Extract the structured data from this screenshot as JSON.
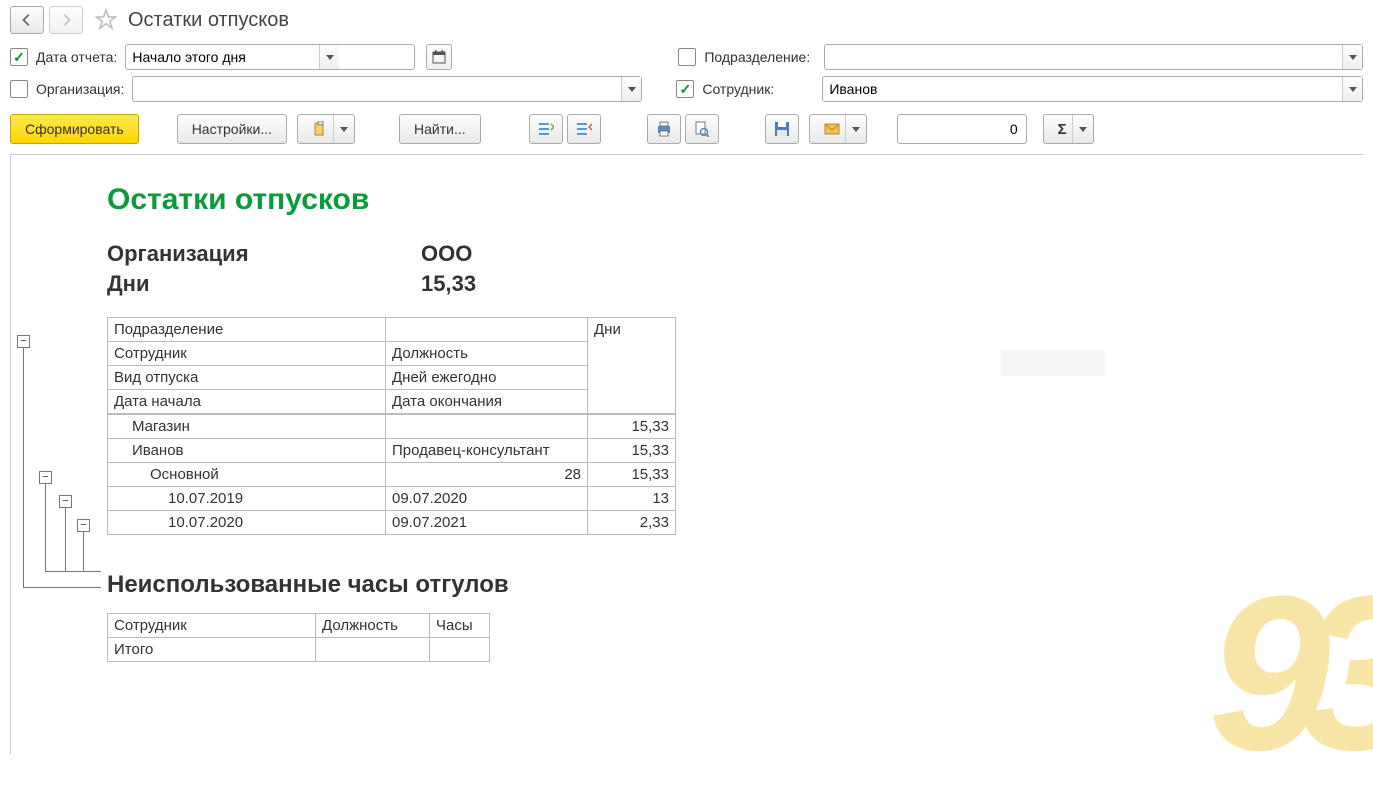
{
  "header": {
    "title": "Остатки отпусков"
  },
  "filters": {
    "report_date": {
      "label": "Дата отчета:",
      "value": "Начало этого дня",
      "checked": true
    },
    "subdivision": {
      "label": "Подразделение:",
      "value": "",
      "checked": false
    },
    "organization": {
      "label": "Организация:",
      "value": "",
      "checked": false
    },
    "employee": {
      "label": "Сотрудник:",
      "value": "Иванов",
      "checked": true
    }
  },
  "toolbar": {
    "generate_label": "Сформировать",
    "settings_label": "Настройки...",
    "find_label": "Найти...",
    "numeric_value": "0"
  },
  "report": {
    "title": "Остатки отпусков",
    "summary": {
      "org_label": "Организация",
      "org_value": "ООО",
      "days_label": "Дни",
      "days_value": "15,33"
    },
    "header_rows": [
      {
        "c1": "Подразделение",
        "c2": "",
        "c3": "Дни"
      },
      {
        "c1": "Сотрудник",
        "c2": "Должность",
        "c3": ""
      },
      {
        "c1": "Вид отпуска",
        "c2": "Дней ежегодно",
        "c3": ""
      },
      {
        "c1": "Дата начала",
        "c2": "Дата окончания",
        "c3": ""
      }
    ],
    "data_rows": [
      {
        "c1": "Магазин",
        "c2": "",
        "c3": "15,33",
        "indent": 1,
        "bold": false
      },
      {
        "c1": "Иванов",
        "c2": "Продавец-консультант",
        "c3": "15,33",
        "indent": 1
      },
      {
        "c1": "Основной",
        "c2": "28",
        "c3": "15,33",
        "indent": 2,
        "c2num": true
      },
      {
        "c1": "10.07.2019",
        "c2": "09.07.2020",
        "c3": "13",
        "indent": 3
      },
      {
        "c1": "10.07.2020",
        "c2": "09.07.2021",
        "c3": "2,33",
        "indent": 3
      }
    ],
    "section2": {
      "title": "Неиспользованные часы отгулов",
      "headers": {
        "c1": "Сотрудник",
        "c2": "Должность",
        "c3": "Часы"
      },
      "total_label": "Итого"
    }
  }
}
